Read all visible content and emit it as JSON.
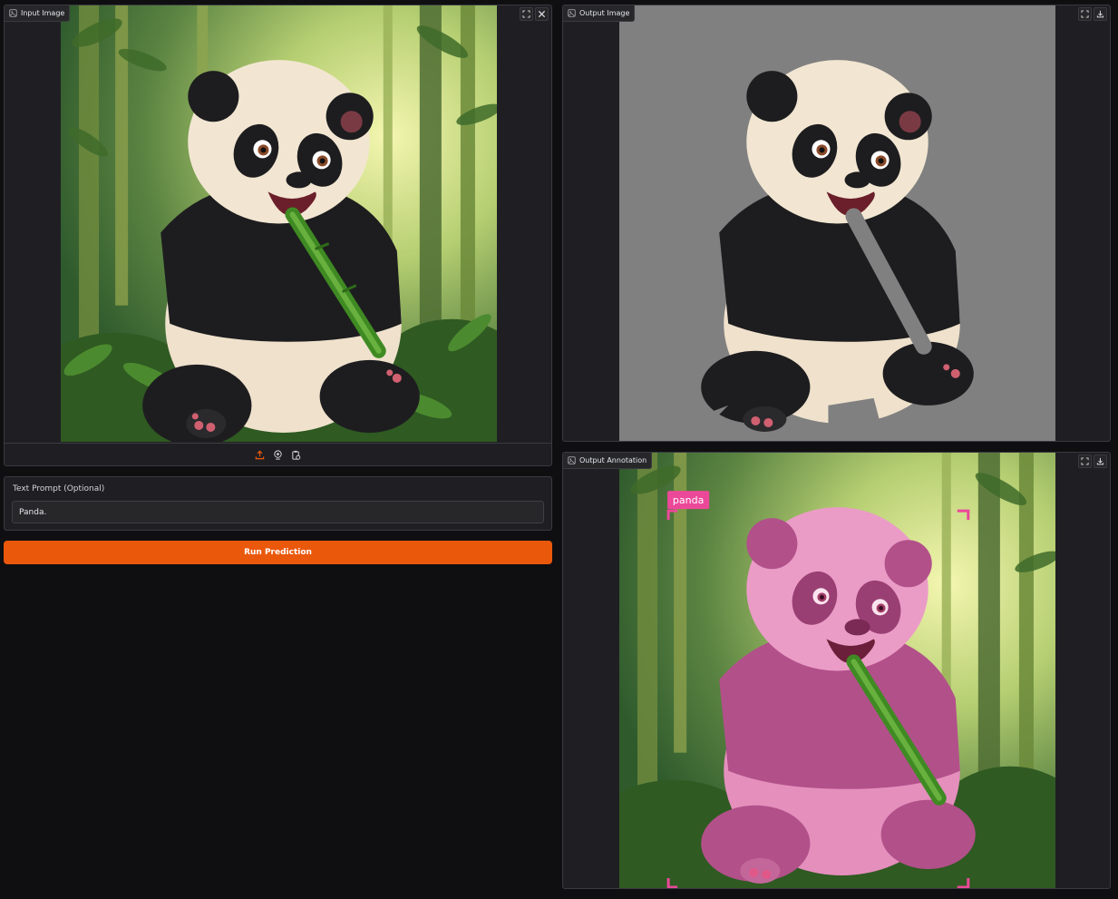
{
  "input_panel": {
    "label": "Input Image",
    "actions": [
      "fullscreen-icon",
      "close-icon"
    ],
    "toolbar": [
      "upload-icon",
      "webcam-icon",
      "clipboard-icon"
    ]
  },
  "prompt_panel": {
    "label": "Text Prompt (Optional)",
    "value": "Panda.",
    "placeholder": ""
  },
  "run_button": {
    "label": "Run Prediction"
  },
  "output_image_panel": {
    "label": "Output Image",
    "actions": [
      "fullscreen-icon",
      "download-icon"
    ]
  },
  "output_annotation_panel": {
    "label": "Output Annotation",
    "actions": [
      "fullscreen-icon",
      "download-icon"
    ],
    "detection_label": "panda"
  },
  "colors": {
    "accent": "#ea580c",
    "annotation": "#ec4899",
    "mask_background": "#808080"
  }
}
